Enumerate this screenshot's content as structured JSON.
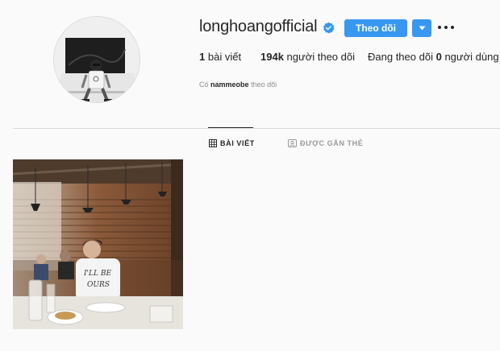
{
  "profile": {
    "username": "longhoangofficial",
    "verified": true,
    "follow_label": "Theo dõi",
    "stats": {
      "posts_count": "1",
      "posts_label": "bài viết",
      "followers_count": "194k",
      "followers_label": "người theo dõi",
      "following_prefix": "Đang theo dõi",
      "following_count": "0",
      "following_suffix": "người dùng"
    },
    "followed_by": {
      "prefix": "Có",
      "name": "nammeobe",
      "suffix": "theo dõi"
    }
  },
  "tabs": [
    {
      "label": "BÀI VIẾT",
      "icon": "grid-icon",
      "active": true
    },
    {
      "label": "ĐƯỢC GẮN THẺ",
      "icon": "tag-icon",
      "active": false
    }
  ],
  "posts": [
    {
      "image": "restaurant-photo"
    }
  ],
  "colors": {
    "accent": "#3897f0",
    "verified": "#3897f0",
    "text": "#262626",
    "muted": "#8e8e8e",
    "divider": "#dbdbdb",
    "background": "#fafafa"
  }
}
